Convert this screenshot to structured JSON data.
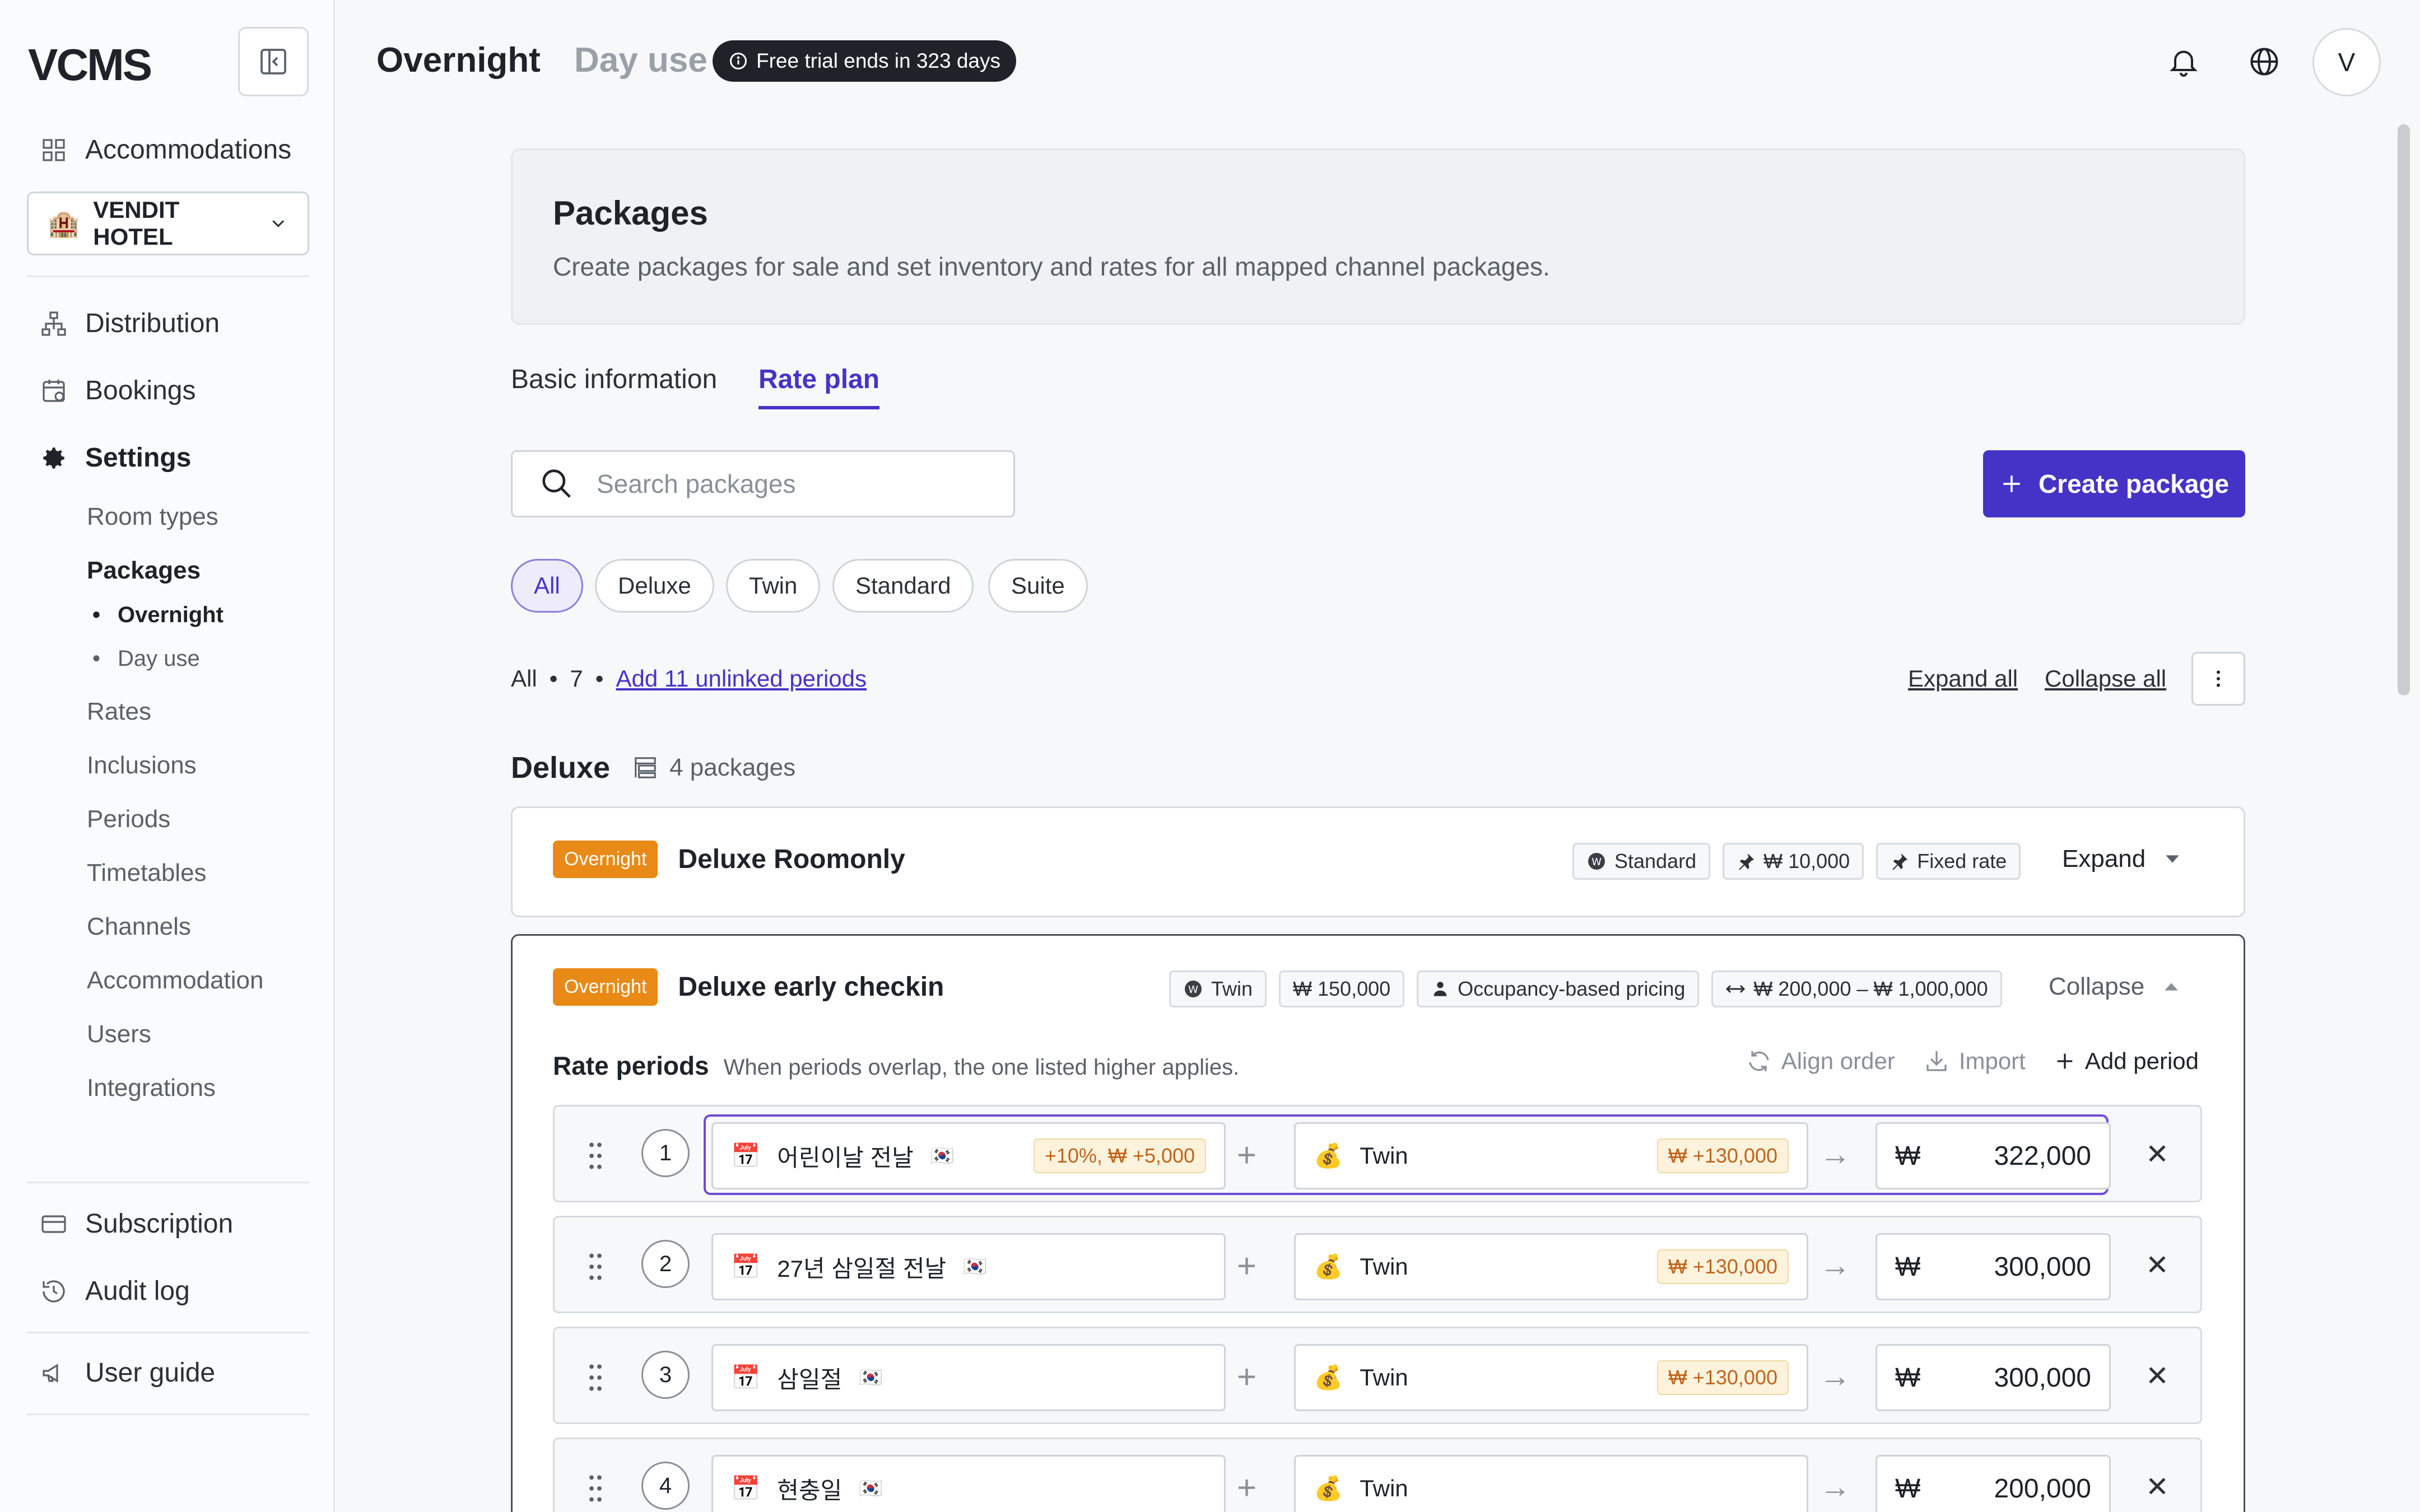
{
  "app": {
    "logo": "VCMS",
    "colors": {
      "accent": "#4533c7",
      "overnight_badge": "#e98a17",
      "adjust_badge": "#fdf3dc"
    }
  },
  "sidebar": {
    "accommodations": "Accommodations",
    "hotel": "VENDIT HOTEL",
    "distribution": "Distribution",
    "bookings": "Bookings",
    "settings": "Settings",
    "settings_items": [
      "Room types",
      "Packages",
      "Rates",
      "Inclusions",
      "Periods",
      "Timetables",
      "Channels",
      "Accommodation",
      "Users",
      "Integrations"
    ],
    "package_items": [
      "Overnight",
      "Day use"
    ],
    "subscription": "Subscription",
    "audit_log": "Audit log",
    "user_guide": "User guide"
  },
  "topbar": {
    "tab_overnight": "Overnight",
    "tab_dayuse": "Day use",
    "trial": "Free trial ends in 323 days",
    "avatar": "V"
  },
  "header": {
    "title": "Packages",
    "description": "Create packages for sale and set inventory and rates for all mapped channel packages."
  },
  "tabs": {
    "basic": "Basic information",
    "rate_plan": "Rate plan"
  },
  "search": {
    "placeholder": "Search packages"
  },
  "create_button": "Create package",
  "filters": [
    "All",
    "Deluxe",
    "Twin",
    "Standard",
    "Suite"
  ],
  "summary": {
    "scope": "All",
    "count": "7",
    "link": "Add 11 unlinked periods"
  },
  "expand_all": "Expand all",
  "collapse_all": "Collapse all",
  "group": {
    "name": "Deluxe",
    "count": "4 packages"
  },
  "packages": [
    {
      "badge": "Overnight",
      "name": "Deluxe Roomonly",
      "tags": [
        "Standard",
        "₩ 10,000",
        "Fixed rate"
      ],
      "toggle": "Expand"
    },
    {
      "badge": "Overnight",
      "name": "Deluxe early checkin",
      "tags": [
        "Twin",
        "₩ 150,000",
        "Occupancy-based pricing",
        "₩ 200,000 – ₩ 1,000,000"
      ],
      "toggle": "Collapse"
    }
  ],
  "rate_periods": {
    "title": "Rate periods",
    "hint": "When periods overlap, the one listed higher applies.",
    "align_order": "Align order",
    "import": "Import",
    "add_period": "Add period",
    "currency": "₩",
    "rows": [
      {
        "num": "1",
        "period": "어린이날 전날",
        "period_adj": "+10%, ₩ +5,000",
        "room": "Twin",
        "room_adj": "₩ +130,000",
        "price": "322,000"
      },
      {
        "num": "2",
        "period": "27년 삼일절 전날",
        "period_adj": "",
        "room": "Twin",
        "room_adj": "₩ +130,000",
        "price": "300,000"
      },
      {
        "num": "3",
        "period": "삼일절",
        "period_adj": "",
        "room": "Twin",
        "room_adj": "₩ +130,000",
        "price": "300,000"
      },
      {
        "num": "4",
        "period": "현충일",
        "period_adj": "",
        "room": "Twin",
        "room_adj": "",
        "price": "200,000"
      }
    ]
  }
}
